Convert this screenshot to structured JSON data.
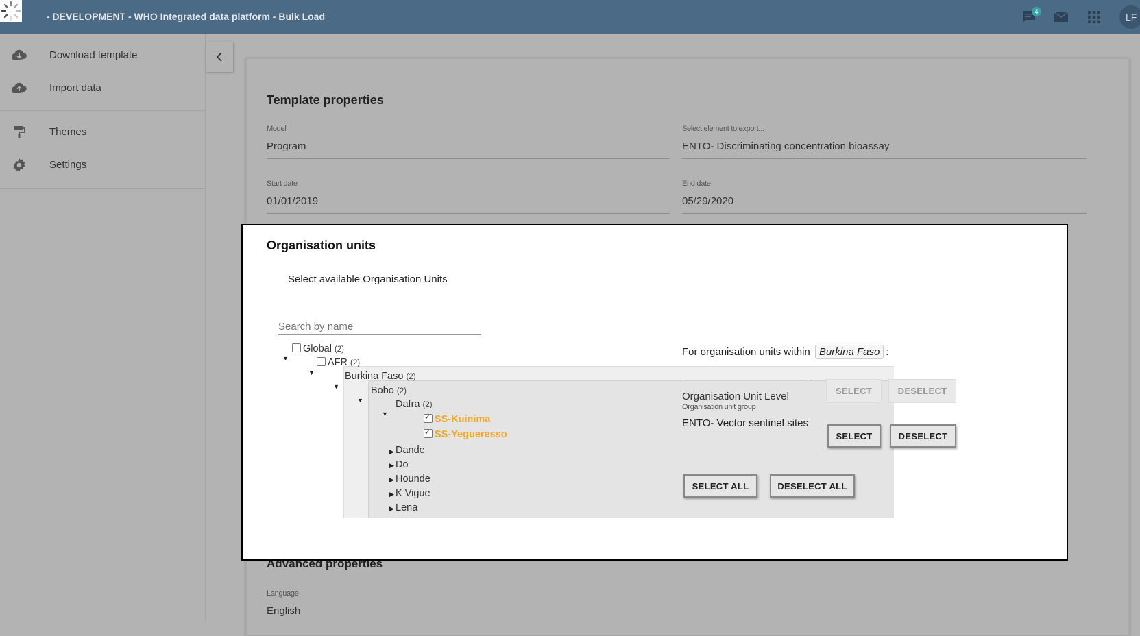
{
  "header": {
    "title": "- DEVELOPMENT - WHO Integrated data platform - Bulk Load",
    "notification_count": "4",
    "avatar_initials": "LF",
    "icons": [
      "loading-spinner-icon",
      "chat-icon",
      "mail-icon",
      "apps-grid-icon"
    ]
  },
  "sidebar": {
    "items": [
      {
        "label": "Download template",
        "icon": "cloud-download-icon"
      },
      {
        "label": "Import data",
        "icon": "cloud-upload-icon"
      },
      {
        "label": "Themes",
        "icon": "paint-roller-icon"
      },
      {
        "label": "Settings",
        "icon": "gear-icon"
      }
    ],
    "collapse_icon": "chevron-left-icon"
  },
  "template_properties": {
    "title": "Template properties",
    "model_label": "Model",
    "model_value": "Program",
    "element_label": "Select element to export...",
    "element_value": "ENTO- Discriminating concentration bioassay",
    "start_label": "Start date",
    "start_value": "01/01/2019",
    "end_label": "End date",
    "end_value": "05/29/2020"
  },
  "org_units": {
    "title": "Organisation units",
    "subtitle": "Select available Organisation Units",
    "search_placeholder": "Search by name",
    "tree": {
      "global": {
        "label": "Global",
        "count": "(2)"
      },
      "afr": {
        "label": "AFR",
        "count": "(2)"
      },
      "burkina": {
        "label": "Burkina Faso",
        "count": "(2)"
      },
      "bobo": {
        "label": "Bobo",
        "count": "(2)"
      },
      "dafra": {
        "label": "Dafra",
        "count": "(2)"
      },
      "kuinima": {
        "label": "SS-Kuinima",
        "checked": true
      },
      "yegueresso": {
        "label": "SS-Yegueresso",
        "checked": true
      },
      "dande": {
        "label": "Dande"
      },
      "do": {
        "label": "Do"
      },
      "hounde": {
        "label": "Hounde"
      },
      "kvigue": {
        "label": "K Vigue"
      },
      "lena": {
        "label": "Lena"
      }
    },
    "within_prefix": "For organisation units within",
    "within_chip": "Burkina Faso",
    "within_suffix": ":",
    "level_label": "Organisation Unit Level",
    "group_label": "Organisation unit group",
    "group_value": "ENTO- Vector sentinel sites",
    "select_label": "SELECT",
    "deselect_label": "DESELECT",
    "select_all_label": "SELECT ALL",
    "deselect_all_label": "DESELECT ALL",
    "selected_color": "#f5a623"
  },
  "advanced_properties": {
    "title": "Advanced properties",
    "language_label": "Language",
    "language_value": "English"
  }
}
